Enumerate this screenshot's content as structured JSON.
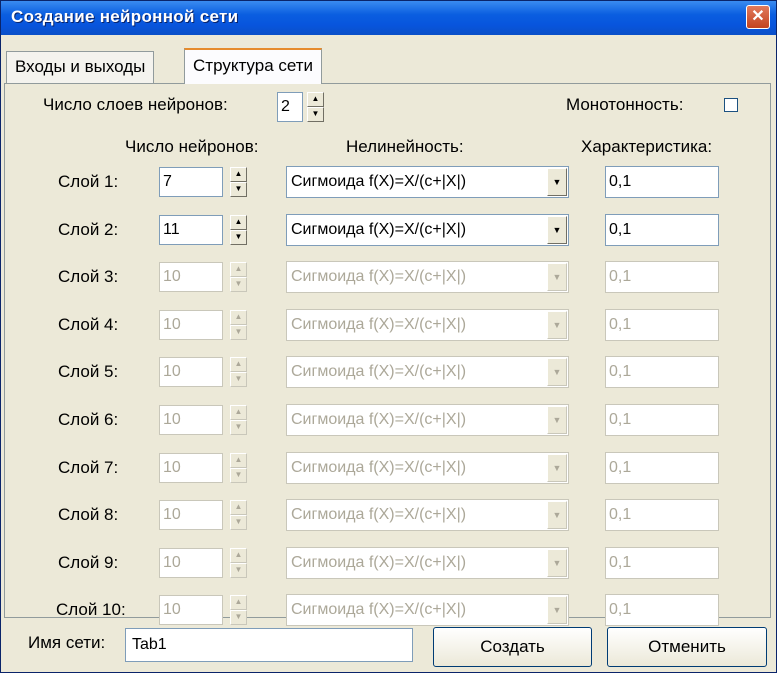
{
  "window": {
    "title": "Создание нейронной сети",
    "close_glyph": "✕"
  },
  "tabs": [
    {
      "label": "Входы и выходы",
      "active": false
    },
    {
      "label": "Структура сети",
      "active": true
    }
  ],
  "structure": {
    "layers_label": "Число слоев нейронов:",
    "layers_value": "2",
    "monotonic_label": "Монотонность:",
    "monotonic_checked": false,
    "col_neurons": "Число нейронов:",
    "col_nonlinearity": "Нелинейность:",
    "col_characteristic": "Характеристика:",
    "layers": [
      {
        "label": "Слой 1:",
        "neurons": "7",
        "nonlinearity": "Сигмоида  f(X)=X/(c+|X|)",
        "characteristic": "0,1",
        "enabled": true
      },
      {
        "label": "Слой 2:",
        "neurons": "11",
        "nonlinearity": "Сигмоида  f(X)=X/(c+|X|)",
        "characteristic": "0,1",
        "enabled": true
      },
      {
        "label": "Слой 3:",
        "neurons": "10",
        "nonlinearity": "Сигмоида  f(X)=X/(c+|X|)",
        "characteristic": "0,1",
        "enabled": false
      },
      {
        "label": "Слой 4:",
        "neurons": "10",
        "nonlinearity": "Сигмоида  f(X)=X/(c+|X|)",
        "characteristic": "0,1",
        "enabled": false
      },
      {
        "label": "Слой 5:",
        "neurons": "10",
        "nonlinearity": "Сигмоида  f(X)=X/(c+|X|)",
        "characteristic": "0,1",
        "enabled": false
      },
      {
        "label": "Слой 6:",
        "neurons": "10",
        "nonlinearity": "Сигмоида  f(X)=X/(c+|X|)",
        "characteristic": "0,1",
        "enabled": false
      },
      {
        "label": "Слой 7:",
        "neurons": "10",
        "nonlinearity": "Сигмоида  f(X)=X/(c+|X|)",
        "characteristic": "0,1",
        "enabled": false
      },
      {
        "label": "Слой 8:",
        "neurons": "10",
        "nonlinearity": "Сигмоида  f(X)=X/(c+|X|)",
        "characteristic": "0,1",
        "enabled": false
      },
      {
        "label": "Слой 9:",
        "neurons": "10",
        "nonlinearity": "Сигмоида  f(X)=X/(c+|X|)",
        "characteristic": "0,1",
        "enabled": false
      },
      {
        "label": "Слой 10:",
        "neurons": "10",
        "nonlinearity": "Сигмоида  f(X)=X/(c+|X|)",
        "characteristic": "0,1",
        "enabled": false
      }
    ]
  },
  "footer": {
    "name_label": "Имя сети:",
    "name_value": "Tab1",
    "create_label": "Создать",
    "cancel_label": "Отменить"
  },
  "colors": {
    "titlebar": "#0a5ee0",
    "dialog_bg": "#ece9d8",
    "disabled_text": "#aca899"
  }
}
